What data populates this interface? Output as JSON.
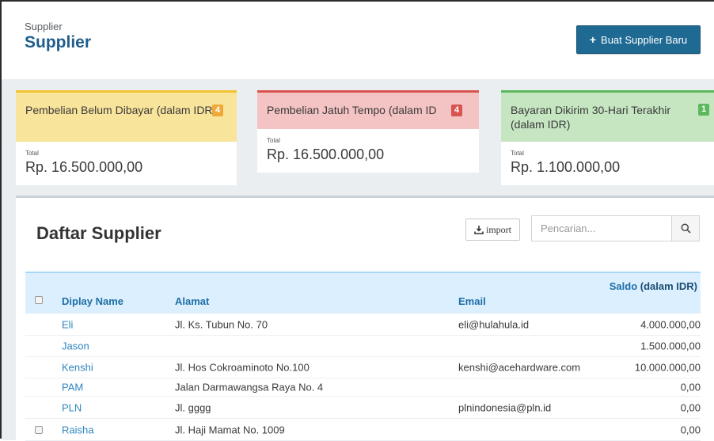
{
  "header": {
    "breadcrumb": "Supplier",
    "title": "Supplier",
    "new_button_label": "Buat Supplier Baru"
  },
  "cards": [
    {
      "title": "Pembelian Belum Dibayar (dalam IDR)",
      "badge": "4",
      "total_label": "Total",
      "total_value": "Rp. 16.500.000,00"
    },
    {
      "title": "Pembelian Jatuh Tempo (dalam ID",
      "badge": "4",
      "total_label": "Total",
      "total_value": "Rp. 16.500.000,00"
    },
    {
      "title": "Bayaran Dikirim 30-Hari Terakhir (dalam IDR)",
      "badge": "1",
      "total_label": "Total",
      "total_value": "Rp. 1.100.000,00"
    }
  ],
  "list": {
    "title": "Daftar Supplier",
    "import_label": "import",
    "search_placeholder": "Pencarian...",
    "columns": {
      "name": "Diplay Name",
      "address": "Alamat",
      "email": "Email",
      "saldo": "Saldo",
      "saldo_unit": "(dalam IDR)"
    },
    "rows": [
      {
        "name": "Eli",
        "address": "Jl. Ks. Tubun No. 70",
        "email": "eli@hulahula.id",
        "saldo": "4.000.000,00",
        "checkbox": false
      },
      {
        "name": "Jason",
        "address": "",
        "email": "",
        "saldo": "1.500.000,00",
        "checkbox": false
      },
      {
        "name": "Kenshi",
        "address": "Jl. Hos Cokroaminoto No.100",
        "email": "kenshi@acehardware.com",
        "saldo": "10.000.000,00",
        "checkbox": false
      },
      {
        "name": "PAM",
        "address": "Jalan Darmawangsa Raya No. 4",
        "email": "",
        "saldo": "0,00",
        "checkbox": false
      },
      {
        "name": "PLN",
        "address": "Jl. gggg",
        "email": "plnindonesia@pln.id",
        "saldo": "0,00",
        "checkbox": false
      },
      {
        "name": "Raisha",
        "address": "Jl. Haji Mamat No. 1009",
        "email": "",
        "saldo": "0,00",
        "checkbox": true
      }
    ]
  },
  "colors": {
    "brand_blue": "#1f6a93",
    "link_blue": "#2e86c1",
    "warning": "#f0a839",
    "danger": "#d9534f",
    "success": "#5cb85c"
  }
}
